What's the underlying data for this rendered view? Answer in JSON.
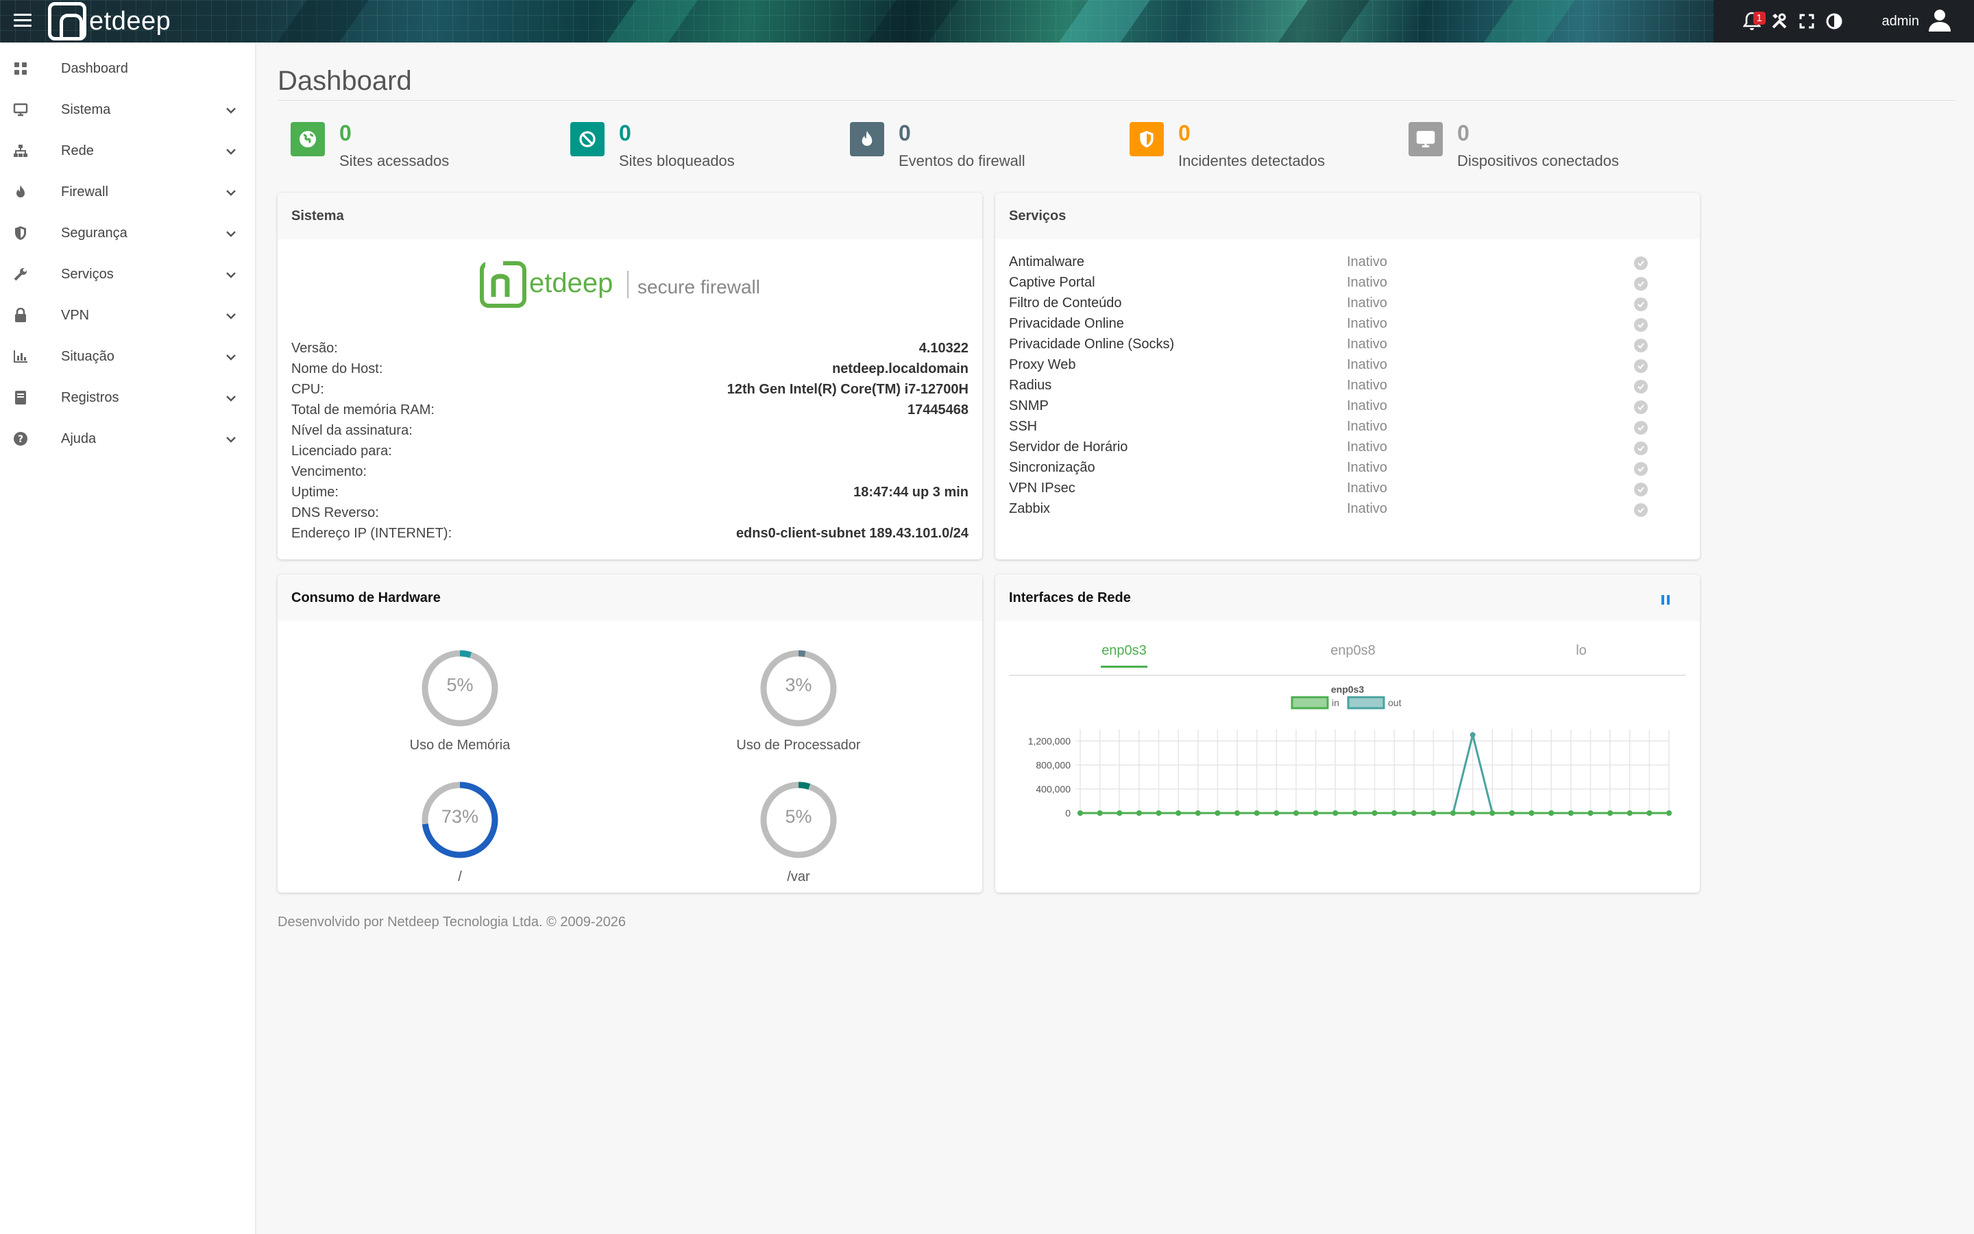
{
  "topbar": {
    "brand": "etdeep",
    "notification_count": "1",
    "user": "admin"
  },
  "sidebar": {
    "items": [
      {
        "label": "Dashboard",
        "icon": "grid-icon",
        "expandable": false
      },
      {
        "label": "Sistema",
        "icon": "monitor-icon",
        "expandable": true
      },
      {
        "label": "Rede",
        "icon": "network-icon",
        "expandable": true
      },
      {
        "label": "Firewall",
        "icon": "fire-icon",
        "expandable": true
      },
      {
        "label": "Segurança",
        "icon": "shield-icon",
        "expandable": true
      },
      {
        "label": "Serviços",
        "icon": "wrench-icon",
        "expandable": true
      },
      {
        "label": "VPN",
        "icon": "lock-icon",
        "expandable": true
      },
      {
        "label": "Situação",
        "icon": "bar-chart-icon",
        "expandable": true
      },
      {
        "label": "Registros",
        "icon": "book-icon",
        "expandable": true
      },
      {
        "label": "Ajuda",
        "icon": "question-icon",
        "expandable": true
      }
    ]
  },
  "page": {
    "title": "Dashboard"
  },
  "stats": [
    {
      "value": "0",
      "label": "Sites acessados",
      "color": "#4caf50",
      "icon": "globe-icon"
    },
    {
      "value": "0",
      "label": "Sites bloqueados",
      "color": "#009688",
      "icon": "ban-icon"
    },
    {
      "value": "0",
      "label": "Eventos do firewall",
      "color": "#546e7a",
      "icon": "fire-icon"
    },
    {
      "value": "0",
      "label": "Incidentes detectados",
      "color": "#ff9800",
      "icon": "shield-icon"
    },
    {
      "value": "0",
      "label": "Dispositivos conectados",
      "color": "#9e9e9e",
      "icon": "monitor-icon"
    }
  ],
  "sistema": {
    "title": "Sistema",
    "logo_word": "etdeep",
    "logo_tagline": "secure firewall",
    "rows": [
      {
        "key": "Versão:",
        "value": "4.10322"
      },
      {
        "key": "Nome do Host:",
        "value": "netdeep.localdomain"
      },
      {
        "key": "CPU:",
        "value": "12th Gen Intel(R) Core(TM) i7-12700H"
      },
      {
        "key": "Total de memória RAM:",
        "value": "17445468"
      },
      {
        "key": "Nível da assinatura:",
        "value": ""
      },
      {
        "key": "Licenciado para:",
        "value": ""
      },
      {
        "key": "Vencimento:",
        "value": ""
      },
      {
        "key": "Uptime:",
        "value": "18:47:44 up 3 min"
      },
      {
        "key": "DNS Reverso:",
        "value": ""
      },
      {
        "key": "Endereço IP (INTERNET):",
        "value": "edns0-client-subnet 189.43.101.0/24"
      }
    ]
  },
  "servicos": {
    "title": "Serviços",
    "rows": [
      {
        "name": "Antimalware",
        "status": "Inativo"
      },
      {
        "name": "Captive Portal",
        "status": "Inativo"
      },
      {
        "name": "Filtro de Conteúdo",
        "status": "Inativo"
      },
      {
        "name": "Privacidade Online",
        "status": "Inativo"
      },
      {
        "name": "Privacidade Online (Socks)",
        "status": "Inativo"
      },
      {
        "name": "Proxy Web",
        "status": "Inativo"
      },
      {
        "name": "Radius",
        "status": "Inativo"
      },
      {
        "name": "SNMP",
        "status": "Inativo"
      },
      {
        "name": "SSH",
        "status": "Inativo"
      },
      {
        "name": "Servidor de Horário",
        "status": "Inativo"
      },
      {
        "name": "Sincronização",
        "status": "Inativo"
      },
      {
        "name": "VPN IPsec",
        "status": "Inativo"
      },
      {
        "name": "Zabbix",
        "status": "Inativo"
      }
    ]
  },
  "hardware": {
    "title": "Consumo de Hardware",
    "gauges": [
      {
        "label": "Uso de Memória",
        "percent": 5,
        "text": "5%",
        "color": "#2196a3"
      },
      {
        "label": "Uso de Processador",
        "percent": 3,
        "text": "3%",
        "color": "#607d8b"
      },
      {
        "label": "/",
        "percent": 73,
        "text": "73%",
        "color": "#1e5fbf"
      },
      {
        "label": "/var",
        "percent": 5,
        "text": "5%",
        "color": "#00796b"
      }
    ]
  },
  "interfaces": {
    "title": "Interfaces de Rede",
    "tabs": [
      "enp0s3",
      "enp0s8",
      "lo"
    ],
    "active_tab": 0
  },
  "chart_data": {
    "type": "line",
    "title": "enp0s3",
    "legend": [
      "in",
      "out"
    ],
    "legend_position": "top-center",
    "grid": true,
    "ylim": [
      0,
      1300000
    ],
    "yticks": [
      "0",
      "400,000",
      "800,000",
      "1,200,000"
    ],
    "series": [
      {
        "name": "in",
        "color": "#4caf50",
        "values": [
          0,
          0,
          0,
          0,
          0,
          0,
          0,
          0,
          0,
          0,
          0,
          0,
          0,
          0,
          0,
          0,
          0,
          0,
          0,
          0,
          0,
          0,
          0,
          0,
          0,
          0,
          0,
          0,
          0,
          0,
          0
        ]
      },
      {
        "name": "out",
        "color": "#4aa3a0",
        "values": [
          0,
          0,
          0,
          0,
          0,
          0,
          0,
          0,
          0,
          0,
          0,
          0,
          0,
          0,
          0,
          0,
          0,
          0,
          0,
          0,
          1300000,
          0,
          0,
          0,
          0,
          0,
          0,
          0,
          0,
          0,
          0
        ]
      }
    ]
  },
  "footer": {
    "text": "Desenvolvido por Netdeep Tecnologia Ltda. © 2009-2026"
  }
}
